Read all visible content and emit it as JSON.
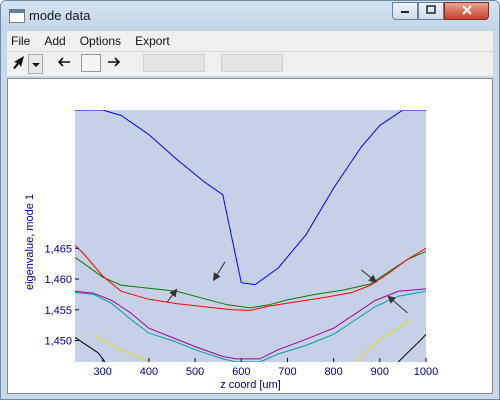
{
  "window": {
    "title": "mode data"
  },
  "menu": {
    "items": [
      "File",
      "Add",
      "Options",
      "Export"
    ]
  },
  "toolbar": {
    "pointer_icon": "arrow-cursor-icon",
    "back_icon": "arrow-left-icon",
    "forward_icon": "arrow-right-icon",
    "index_value": "",
    "field1_value": "",
    "field2_value": ""
  },
  "colors": {
    "plot_bg": "#c6d0e6",
    "axis_text": "#00008b",
    "blue": "#0000ff",
    "green": "#008000",
    "red": "#ff0000",
    "purple": "#a000a0",
    "teal": "#00a0a0",
    "yellow": "#e0e000",
    "black": "#000000"
  },
  "chart_data": {
    "type": "line",
    "xlabel": "z coord [um]",
    "ylabel": "eigenvalue, mode 1",
    "xlim": [
      240,
      1000
    ],
    "ylim": [
      1.4465,
      1.4875
    ],
    "x_ticks": [
      300,
      400,
      500,
      600,
      700,
      800,
      900,
      1000
    ],
    "y_ticks": [
      1.45,
      1.455,
      1.46,
      1.465
    ],
    "x_tick_labels": [
      "300",
      "400",
      "500",
      "600",
      "700",
      "800",
      "900",
      "1000"
    ],
    "y_tick_labels": [
      "1,450",
      "1,455",
      "1,460",
      "1,465"
    ],
    "grid": false,
    "series": [
      {
        "color": "#0000ff",
        "points": [
          [
            240,
            1.4875
          ],
          [
            300,
            1.4875
          ],
          [
            340,
            1.4866
          ],
          [
            400,
            1.4835
          ],
          [
            460,
            1.4795
          ],
          [
            520,
            1.4758
          ],
          [
            560,
            1.4737
          ],
          [
            600,
            1.4594
          ],
          [
            630,
            1.4591
          ],
          [
            680,
            1.4618
          ],
          [
            740,
            1.4672
          ],
          [
            800,
            1.4748
          ],
          [
            860,
            1.4815
          ],
          [
            900,
            1.485
          ],
          [
            950,
            1.4875
          ],
          [
            1000,
            1.4875
          ]
        ]
      },
      {
        "color": "#008000",
        "points": [
          [
            240,
            1.4635
          ],
          [
            260,
            1.4625
          ],
          [
            300,
            1.4603
          ],
          [
            340,
            1.459
          ],
          [
            400,
            1.4585
          ],
          [
            460,
            1.458
          ],
          [
            520,
            1.4568
          ],
          [
            570,
            1.4558
          ],
          [
            620,
            1.4553
          ],
          [
            660,
            1.4558
          ],
          [
            700,
            1.4566
          ],
          [
            760,
            1.4575
          ],
          [
            820,
            1.4582
          ],
          [
            880,
            1.4592
          ],
          [
            920,
            1.4612
          ],
          [
            960,
            1.4632
          ],
          [
            1000,
            1.4645
          ]
        ]
      },
      {
        "color": "#ff0000",
        "points": [
          [
            240,
            1.4655
          ],
          [
            260,
            1.464
          ],
          [
            300,
            1.4605
          ],
          [
            340,
            1.458
          ],
          [
            400,
            1.4567
          ],
          [
            460,
            1.456
          ],
          [
            520,
            1.4555
          ],
          [
            580,
            1.455
          ],
          [
            620,
            1.4549
          ],
          [
            660,
            1.4556
          ],
          [
            720,
            1.4563
          ],
          [
            780,
            1.457
          ],
          [
            840,
            1.4578
          ],
          [
            880,
            1.459
          ],
          [
            920,
            1.461
          ],
          [
            960,
            1.4632
          ],
          [
            1000,
            1.465
          ]
        ]
      },
      {
        "color": "#a000a0",
        "points": [
          [
            240,
            1.458
          ],
          [
            280,
            1.4577
          ],
          [
            320,
            1.4565
          ],
          [
            360,
            1.4545
          ],
          [
            400,
            1.452
          ],
          [
            450,
            1.4505
          ],
          [
            500,
            1.449
          ],
          [
            560,
            1.4474
          ],
          [
            590,
            1.447
          ],
          [
            640,
            1.447
          ],
          [
            680,
            1.4485
          ],
          [
            740,
            1.4502
          ],
          [
            800,
            1.452
          ],
          [
            850,
            1.4545
          ],
          [
            890,
            1.4565
          ],
          [
            940,
            1.458
          ],
          [
            1000,
            1.4584
          ]
        ]
      },
      {
        "color": "#00a0a0",
        "points": [
          [
            240,
            1.4578
          ],
          [
            280,
            1.4575
          ],
          [
            320,
            1.456
          ],
          [
            360,
            1.4535
          ],
          [
            400,
            1.4512
          ],
          [
            450,
            1.45
          ],
          [
            500,
            1.4485
          ],
          [
            560,
            1.447
          ],
          [
            590,
            1.4465
          ],
          [
            640,
            1.4465
          ],
          [
            680,
            1.4478
          ],
          [
            740,
            1.4492
          ],
          [
            800,
            1.451
          ],
          [
            850,
            1.4535
          ],
          [
            890,
            1.4555
          ],
          [
            940,
            1.4572
          ],
          [
            1000,
            1.458
          ]
        ]
      },
      {
        "color": "#e0e000",
        "points": [
          [
            280,
            1.451
          ],
          [
            300,
            1.45
          ],
          [
            340,
            1.4485
          ],
          [
            380,
            1.4472
          ],
          [
            400,
            1.4465
          ]
        ]
      },
      {
        "color": "#e0e000",
        "points": [
          [
            850,
            1.4465
          ],
          [
            870,
            1.4482
          ],
          [
            900,
            1.4502
          ],
          [
            940,
            1.452
          ],
          [
            970,
            1.4535
          ]
        ]
      },
      {
        "color": "#000000",
        "points": [
          [
            240,
            1.4505
          ],
          [
            260,
            1.4495
          ],
          [
            290,
            1.448
          ],
          [
            305,
            1.4465
          ]
        ]
      },
      {
        "color": "#000000",
        "points": [
          [
            940,
            1.4465
          ],
          [
            960,
            1.448
          ],
          [
            990,
            1.4502
          ],
          [
            1000,
            1.451
          ]
        ]
      }
    ],
    "annotations": [
      {
        "type": "arrow",
        "from": [
          565,
          1.4628
        ],
        "to": [
          540,
          1.4598
        ]
      },
      {
        "type": "arrow",
        "from": [
          440,
          1.4563
        ],
        "to": [
          460,
          1.4583
        ]
      },
      {
        "type": "arrow",
        "from": [
          860,
          1.4615
        ],
        "to": [
          892,
          1.4595
        ]
      },
      {
        "type": "arrow",
        "from": [
          960,
          1.4545
        ],
        "to": [
          918,
          1.4572
        ]
      }
    ]
  }
}
